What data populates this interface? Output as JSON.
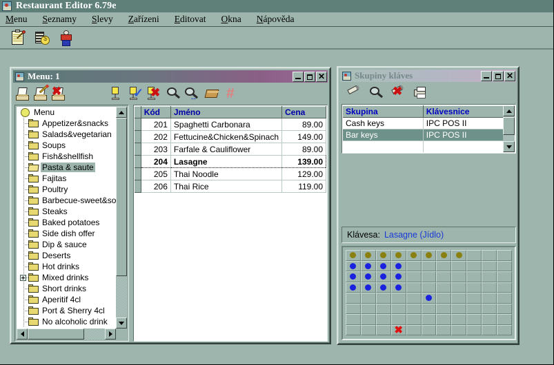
{
  "app": {
    "title": "Restaurant Editor 6.79e",
    "icon": "restaurant-app-icon",
    "menubar": [
      {
        "pre": "",
        "acc": "M",
        "post": "enu"
      },
      {
        "pre": "",
        "acc": "S",
        "post": "eznamy"
      },
      {
        "pre": "",
        "acc": "S",
        "post": "levy"
      },
      {
        "pre": "",
        "acc": "Z",
        "post": "ařízeni"
      },
      {
        "pre": "",
        "acc": "E",
        "post": "ditovat"
      },
      {
        "pre": "",
        "acc": "O",
        "post": "kna"
      },
      {
        "pre": "",
        "acc": "N",
        "post": "ápověda"
      }
    ],
    "toolbar": [
      {
        "name": "edit-menu-card-icon"
      },
      {
        "name": "price-list-icon"
      },
      {
        "name": "staff-icon"
      }
    ]
  },
  "menu_window": {
    "title": "Menu: 1",
    "icon": "restaurant-app-icon",
    "buttons": {
      "minimize": "_",
      "maximize": "□",
      "close": "✕"
    },
    "toolbar_left": [
      {
        "name": "new-record-icon"
      },
      {
        "name": "edit-record-icon"
      },
      {
        "name": "delete-record-icon"
      }
    ],
    "toolbar_right": [
      {
        "name": "insert-item-icon"
      },
      {
        "name": "confirm-item-icon"
      },
      {
        "name": "cancel-item-icon"
      },
      {
        "name": "search-icon"
      },
      {
        "name": "search-next-icon"
      },
      {
        "name": "book-icon"
      },
      {
        "name": "grid-hash-icon"
      }
    ],
    "tree": {
      "root": {
        "label": "Menu",
        "icon": "globe-icon"
      },
      "items": [
        {
          "label": "Appetizer&snacks",
          "expandable": false,
          "selected": false
        },
        {
          "label": "Salads&vegetarian",
          "expandable": false,
          "selected": false
        },
        {
          "label": "Soups",
          "expandable": false,
          "selected": false
        },
        {
          "label": "Fish&shellfish",
          "expandable": false,
          "selected": false
        },
        {
          "label": "Pasta & saute",
          "expandable": false,
          "selected": true
        },
        {
          "label": "Fajitas",
          "expandable": false,
          "selected": false
        },
        {
          "label": "Poultry",
          "expandable": false,
          "selected": false
        },
        {
          "label": "Barbecue-sweet&sou",
          "expandable": false,
          "selected": false
        },
        {
          "label": "Steaks",
          "expandable": false,
          "selected": false
        },
        {
          "label": "Baked potatoes",
          "expandable": false,
          "selected": false
        },
        {
          "label": "Side dish offer",
          "expandable": false,
          "selected": false
        },
        {
          "label": "Dip & sauce",
          "expandable": false,
          "selected": false
        },
        {
          "label": "Deserts",
          "expandable": false,
          "selected": false
        },
        {
          "label": "Hot drinks",
          "expandable": false,
          "selected": false
        },
        {
          "label": "Mixed drinks",
          "expandable": true,
          "selected": false
        },
        {
          "label": "Short drinks",
          "expandable": false,
          "selected": false
        },
        {
          "label": "Aperitif 4cl",
          "expandable": false,
          "selected": false
        },
        {
          "label": "Port & Sherry 4cl",
          "expandable": false,
          "selected": false
        },
        {
          "label": "No alcoholic drink",
          "expandable": false,
          "selected": false
        }
      ]
    },
    "grid": {
      "columns": [
        "Kód",
        "Jméno",
        "Cena"
      ],
      "rows": [
        {
          "code": "201",
          "name": "Spaghetti Carbonara",
          "price": "89.00",
          "selected": false
        },
        {
          "code": "202",
          "name": "Fettucine&Chicken&Spinach",
          "price": "149.00",
          "selected": false
        },
        {
          "code": "203",
          "name": "Farfale & Cauliflower",
          "price": "89.00",
          "selected": false
        },
        {
          "code": "204",
          "name": "Lasagne",
          "price": "139.00",
          "selected": true
        },
        {
          "code": "205",
          "name": "Thai Noodle",
          "price": "129.00",
          "selected": false
        },
        {
          "code": "206",
          "name": "Thai Rice",
          "price": "119.00",
          "selected": false
        }
      ]
    }
  },
  "keys_window": {
    "title": "Skupiny kláves",
    "icon": "restaurant-app-icon",
    "buttons": {
      "minimize": "_",
      "maximize": "□",
      "close": "✕"
    },
    "toolbar": [
      {
        "name": "edit-group-icon"
      },
      {
        "name": "search-icon"
      },
      {
        "name": "delete-group-icon"
      },
      {
        "name": "print-icon"
      }
    ],
    "groups": {
      "columns": [
        "Skupina",
        "Klávesnice"
      ],
      "rows": [
        {
          "group": "Cash keys",
          "keyboard": "IPC POS II",
          "selected": false
        },
        {
          "group": "Bar keys",
          "keyboard": "IPC POS II",
          "selected": true
        }
      ]
    },
    "key_label": {
      "prefix": "Klávesa:",
      "value": "Lasagne (Jídlo)"
    },
    "keygrid": {
      "cols": 11,
      "rows": 8,
      "colors": {
        "olive": "#8a8010",
        "blue": "#1a22e0",
        "cross": "#e01010"
      },
      "cells": [
        [
          "olive",
          "olive",
          "olive",
          "olive",
          "olive",
          "olive",
          "olive",
          "olive",
          "",
          "",
          ""
        ],
        [
          "blue",
          "blue",
          "blue",
          "blue",
          "",
          "",
          "",
          "",
          "",
          "",
          ""
        ],
        [
          "blue",
          "blue",
          "blue",
          "blue",
          "",
          "",
          "",
          "",
          "",
          "",
          ""
        ],
        [
          "blue",
          "blue",
          "blue",
          "blue",
          "",
          "",
          "",
          "",
          "",
          "",
          ""
        ],
        [
          "",
          "",
          "",
          "",
          "",
          "blue",
          "",
          "",
          "",
          "",
          ""
        ],
        [
          "",
          "",
          "",
          "",
          "",
          "",
          "",
          "",
          "",
          "",
          ""
        ],
        [
          "",
          "",
          "",
          "",
          "",
          "",
          "",
          "",
          "",
          "",
          ""
        ],
        [
          "",
          "",
          "",
          "cross",
          "",
          "",
          "",
          "",
          "",
          "",
          ""
        ]
      ]
    }
  }
}
